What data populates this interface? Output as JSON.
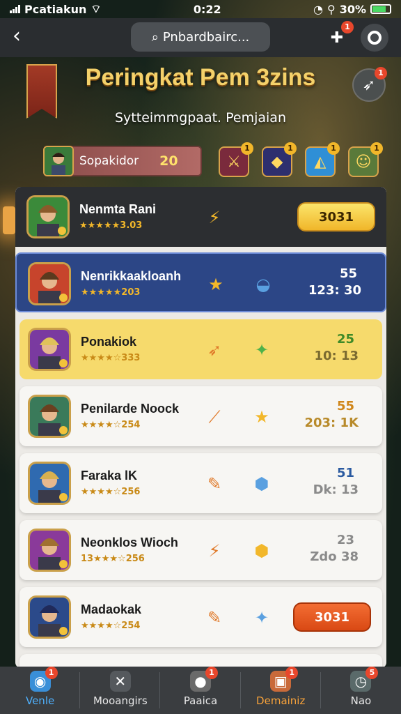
{
  "status_bar": {
    "carrier": "Pcatiakun",
    "time": "0:22",
    "battery": "30%"
  },
  "nav": {
    "search_text": "Pnbardbairc...",
    "badge_count": "1"
  },
  "header": {
    "title": "Peringkat Pem 3zins",
    "subtitle": "Sytteimmgpaat. Pemjaian",
    "icon_badge": "1"
  },
  "player": {
    "name": "Sopakidor",
    "score": "20"
  },
  "achievements": [
    {
      "icon": "gem-shield-icon",
      "badge": "1",
      "color": "#7a2a3c",
      "glyph": "⚔"
    },
    {
      "icon": "gold-cube-icon",
      "badge": "1",
      "color": "#2e2f6e",
      "glyph": "◆"
    },
    {
      "icon": "blue-emblem-icon",
      "badge": "1",
      "color": "#2f8fd6",
      "glyph": "◭"
    },
    {
      "icon": "hero-portrait-icon",
      "badge": "1",
      "color": "#5a7a3a",
      "glyph": "☺"
    }
  ],
  "rows": [
    {
      "name": "Nenmta Rani",
      "stars": "★★★★★3.03",
      "item1": "⚡",
      "item2": "",
      "score_top": "",
      "score_bot": "",
      "button": "3031",
      "style": "first"
    },
    {
      "name": "Nenrikkaakloanh",
      "stars": "★★★★★203",
      "item1": "★",
      "item2": "◒",
      "score_top": "55",
      "score_bot": "123: 30",
      "button": "",
      "style": "blue"
    },
    {
      "name": "Ponakiok",
      "stars": "★★★★☆333",
      "item1": "➶",
      "item2": "✦",
      "score_top": "25",
      "score_bot": "10: 13",
      "button": "",
      "style": "gold"
    },
    {
      "name": "Penilarde Noock",
      "stars": "★★★★☆254",
      "item1": "⟋",
      "item2": "★",
      "score_top": "55",
      "score_bot": "203: 1K",
      "button": "",
      "style": "card"
    },
    {
      "name": "Faraka lK",
      "stars": "★★★★☆256",
      "item1": "✎",
      "item2": "⬢",
      "score_top": "51",
      "score_bot": "Dk: 13",
      "button": "",
      "style": "card"
    },
    {
      "name": "Neonklos Wioch",
      "stars": "13★★★☆256",
      "item1": "⚡",
      "item2": "⬢",
      "score_top": "23",
      "score_bot": "Zdo 38",
      "button": "",
      "style": "card"
    },
    {
      "name": "Madaokak",
      "stars": "★★★★☆254",
      "item1": "✎",
      "item2": "✦",
      "score_top": "",
      "score_bot": "",
      "button": "3031",
      "style": "card"
    }
  ],
  "tabs": [
    {
      "label": "Venle",
      "icon": "shield-icon",
      "badge": "1",
      "glyph": "◉"
    },
    {
      "label": "Mooangirs",
      "icon": "crossed-swords-icon",
      "badge": "",
      "glyph": "✕"
    },
    {
      "label": "Paaica",
      "icon": "orb-icon",
      "badge": "1",
      "glyph": "●"
    },
    {
      "label": "Demainiz",
      "icon": "chest-icon",
      "badge": "1",
      "glyph": "▣"
    },
    {
      "label": "Nao",
      "icon": "clock-icon",
      "badge": "5",
      "glyph": "◷"
    }
  ]
}
